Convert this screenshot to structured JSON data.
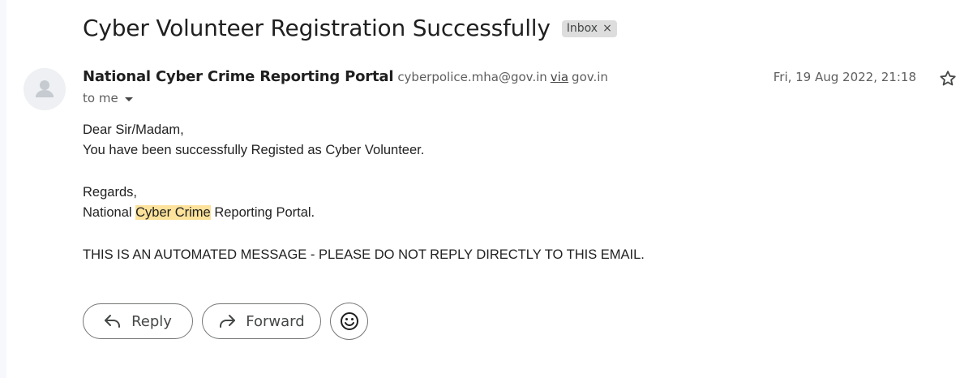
{
  "email": {
    "subject": "Cyber Volunteer Registration Successfully",
    "label": {
      "text": "Inbox",
      "close_glyph": "×"
    },
    "sender": {
      "name": "National Cyber Crime Reporting Portal",
      "email": "cyberpolice.mha@gov.in",
      "via_label": "via",
      "via_domain": "gov.in",
      "avatar_icon": "default-person-avatar"
    },
    "recipient": "to me",
    "date": "Fri, 19 Aug 2022, 21:18",
    "star_icon": "star-outline-icon",
    "body": {
      "greeting": "Dear Sir/Madam,",
      "line1": "You have been successfully Registed as Cyber Volunteer.",
      "regards": "Regards,",
      "signature_pre": "National ",
      "signature_highlight": "Cyber Crime",
      "signature_post": " Reporting Portal.",
      "notice": "THIS IS AN AUTOMATED MESSAGE - PLEASE DO NOT REPLY DIRECTLY TO THIS EMAIL."
    }
  },
  "actions": {
    "reply_label": "Reply",
    "forward_label": "Forward",
    "reply_icon": "reply-arrow-icon",
    "forward_icon": "forward-arrow-icon",
    "emoji_icon": "emoji-smiley-icon"
  },
  "colors": {
    "highlight": "#fce29a",
    "label_chip_bg": "#dddddd"
  }
}
